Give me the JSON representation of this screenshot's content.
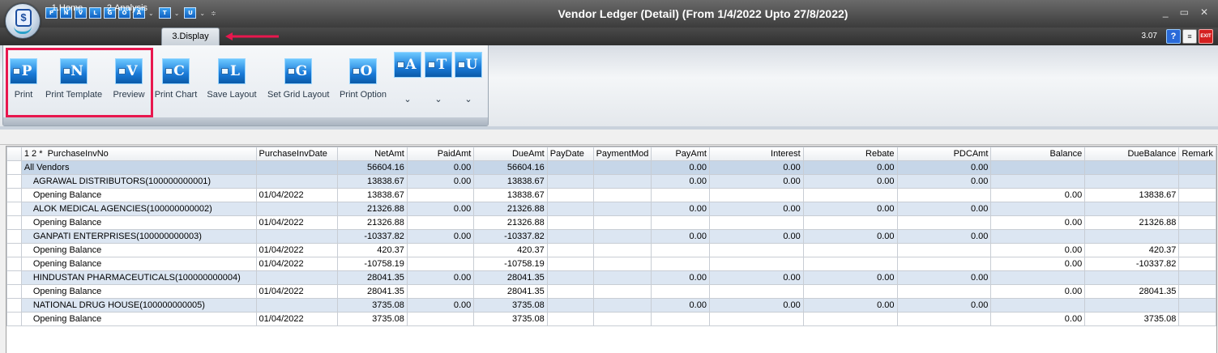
{
  "window": {
    "title": "Vendor Ledger (Detail)  (From 1/4/2022 Upto 27/8/2022)",
    "version": "3.07"
  },
  "logo": {
    "symbol": "$"
  },
  "quick_access": [
    {
      "letter": "P"
    },
    {
      "letter": "N"
    },
    {
      "letter": "V"
    },
    {
      "letter": "L"
    },
    {
      "letter": "G"
    },
    {
      "letter": "O"
    },
    {
      "letter": "A"
    },
    {
      "letter": "T"
    },
    {
      "letter": "U"
    }
  ],
  "window_controls": {
    "minimize": "_",
    "restore": "▭",
    "close": "✕"
  },
  "tabs": [
    {
      "label": "1.Home"
    },
    {
      "label": "2.Analysis"
    },
    {
      "label": "3.Display"
    }
  ],
  "active_tab": "3.Display",
  "help": {
    "help_icon": "?",
    "info_icon": "≡",
    "exit_icon": "EXIT"
  },
  "ribbon": {
    "buttons": [
      {
        "letter": "P",
        "label": "Print"
      },
      {
        "letter": "N",
        "label": "Print Template"
      },
      {
        "letter": "V",
        "label": "Preview"
      },
      {
        "letter": "C",
        "label": "Print Chart"
      },
      {
        "letter": "L",
        "label": "Save Layout"
      },
      {
        "letter": "G",
        "label": "Set Grid Layout"
      },
      {
        "letter": "O",
        "label": "Print Option"
      },
      {
        "letter": "A",
        "label": "⌄"
      },
      {
        "letter": "T",
        "label": "⌄"
      },
      {
        "letter": "U",
        "label": "⌄"
      }
    ]
  },
  "grid": {
    "group_markers": [
      "1",
      "2",
      "*"
    ],
    "columns": [
      "PurchaseInvNo",
      "PurchaseInvDate",
      "NetAmt",
      "PaidAmt",
      "DueAmt",
      "PayDate",
      "PaymentMod",
      "PayAmt",
      "Interest",
      "Rebate",
      "PDCAmt",
      "Balance",
      "DueBalance",
      "Remark"
    ],
    "rows": [
      {
        "type": "top",
        "cells": [
          "All Vendors",
          "",
          "56604.16",
          "0.00",
          "56604.16",
          "",
          "",
          "0.00",
          "0.00",
          "0.00",
          "0.00",
          "",
          "",
          ""
        ]
      },
      {
        "type": "grp",
        "cells": [
          "AGRAWAL DISTRIBUTORS(100000000001)",
          "",
          "13838.67",
          "0.00",
          "13838.67",
          "",
          "",
          "0.00",
          "0.00",
          "0.00",
          "0.00",
          "",
          "",
          ""
        ]
      },
      {
        "type": "det",
        "cells": [
          "Opening Balance",
          "01/04/2022",
          "13838.67",
          "",
          "13838.67",
          "",
          "",
          "",
          "",
          "",
          "",
          "0.00",
          "13838.67",
          ""
        ]
      },
      {
        "type": "grp",
        "cells": [
          "ALOK MEDICAL AGENCIES(100000000002)",
          "",
          "21326.88",
          "0.00",
          "21326.88",
          "",
          "",
          "0.00",
          "0.00",
          "0.00",
          "0.00",
          "",
          "",
          ""
        ]
      },
      {
        "type": "det",
        "cells": [
          "Opening Balance",
          "01/04/2022",
          "21326.88",
          "",
          "21326.88",
          "",
          "",
          "",
          "",
          "",
          "",
          "0.00",
          "21326.88",
          ""
        ]
      },
      {
        "type": "grp",
        "cells": [
          "GANPATI ENTERPRISES(100000000003)",
          "",
          "-10337.82",
          "0.00",
          "-10337.82",
          "",
          "",
          "0.00",
          "0.00",
          "0.00",
          "0.00",
          "",
          "",
          ""
        ]
      },
      {
        "type": "det",
        "cells": [
          "Opening Balance",
          "01/04/2022",
          "420.37",
          "",
          "420.37",
          "",
          "",
          "",
          "",
          "",
          "",
          "0.00",
          "420.37",
          ""
        ]
      },
      {
        "type": "det",
        "cells": [
          "Opening Balance",
          "01/04/2022",
          "-10758.19",
          "",
          "-10758.19",
          "",
          "",
          "",
          "",
          "",
          "",
          "0.00",
          "-10337.82",
          ""
        ]
      },
      {
        "type": "grp",
        "cells": [
          "HINDUSTAN PHARMACEUTICALS(100000000004)",
          "",
          "28041.35",
          "0.00",
          "28041.35",
          "",
          "",
          "0.00",
          "0.00",
          "0.00",
          "0.00",
          "",
          "",
          ""
        ]
      },
      {
        "type": "det",
        "cells": [
          "Opening Balance",
          "01/04/2022",
          "28041.35",
          "",
          "28041.35",
          "",
          "",
          "",
          "",
          "",
          "",
          "0.00",
          "28041.35",
          ""
        ]
      },
      {
        "type": "grp",
        "cells": [
          "NATIONAL DRUG HOUSE(100000000005)",
          "",
          "3735.08",
          "0.00",
          "3735.08",
          "",
          "",
          "0.00",
          "0.00",
          "0.00",
          "0.00",
          "",
          "",
          ""
        ]
      },
      {
        "type": "det",
        "cells": [
          "Opening Balance",
          "01/04/2022",
          "3735.08",
          "",
          "3735.08",
          "",
          "",
          "",
          "",
          "",
          "",
          "0.00",
          "3735.08",
          ""
        ]
      }
    ]
  },
  "colors": {
    "highlight": "#e8174e",
    "group_row": "#dce6f2",
    "top_row": "#c6d6e8",
    "icon_blue": "#1a7ad8"
  }
}
